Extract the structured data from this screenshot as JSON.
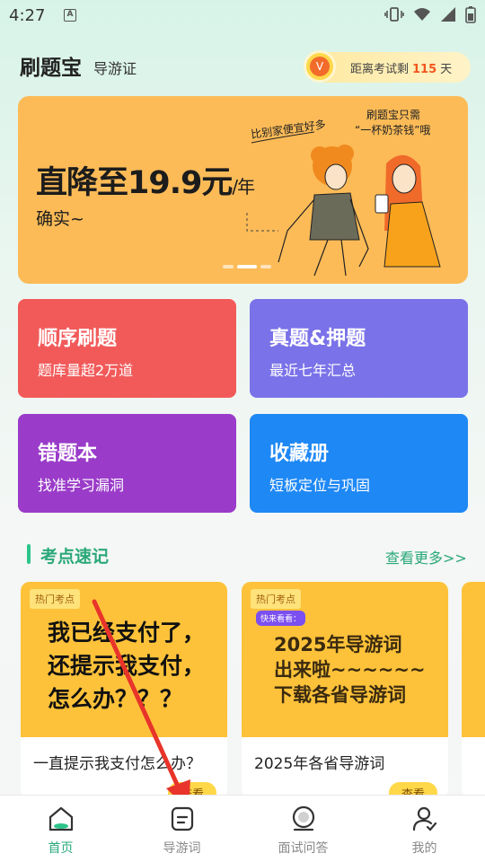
{
  "status_bar": {
    "time": "4:27",
    "notification_letter": "A"
  },
  "header": {
    "app_title": "刷题宝",
    "subtitle": "导游证",
    "exam_avatar_letter": "V",
    "exam_countdown_prefix": "距离考试剩",
    "exam_countdown_days": "115",
    "exam_countdown_suffix": "天"
  },
  "banner": {
    "price_text": "直降至19.9元",
    "unit": "/年",
    "subtitle": "确实~",
    "bubble_left": "比别家便宜好多",
    "bubble_right_line1": "刷题宝只需",
    "bubble_right_line2": "“一杯奶茶钱”哦",
    "slide_count": 2,
    "active_slide": 1,
    "color": "#fcbb57"
  },
  "tiles": [
    {
      "title": "顺序刷题",
      "subtitle": "题库量超2万道",
      "color": "#f25a5a"
    },
    {
      "title": "真题&押题",
      "subtitle": "最近七年汇总",
      "color": "#7a72e8"
    },
    {
      "title": "错题本",
      "subtitle": "找准学习漏洞",
      "color": "#9a3bc9"
    },
    {
      "title": "收藏册",
      "subtitle": "短板定位与巩固",
      "color": "#1e88f5"
    }
  ],
  "section": {
    "title": "考点速记",
    "more_label": "查看更多>>"
  },
  "cards": [
    {
      "tag": "热门考点",
      "image_lines": [
        "我已经支付了，",
        "还提示我支付，",
        "怎么办？？？"
      ],
      "title": "一直提示我支付怎么办？",
      "view_label": "查看"
    },
    {
      "tag": "热门考点",
      "badge": "快来看看：",
      "image_lines": [
        "2025年导游词",
        "出来啦~~~~~~",
        "下载各省导游词"
      ],
      "title": "2025年各省导游词",
      "view_label": "查看"
    }
  ],
  "bottom_nav": [
    {
      "label": "首页",
      "icon": "home-icon",
      "active": true
    },
    {
      "label": "导游词",
      "icon": "document-icon",
      "active": false
    },
    {
      "label": "面试问答",
      "icon": "interview-icon",
      "active": false
    },
    {
      "label": "我的",
      "icon": "profile-icon",
      "active": false
    }
  ],
  "colors": {
    "accent": "#2aa87a",
    "highlight": "#f2561d",
    "arrow": "#e8342a"
  }
}
